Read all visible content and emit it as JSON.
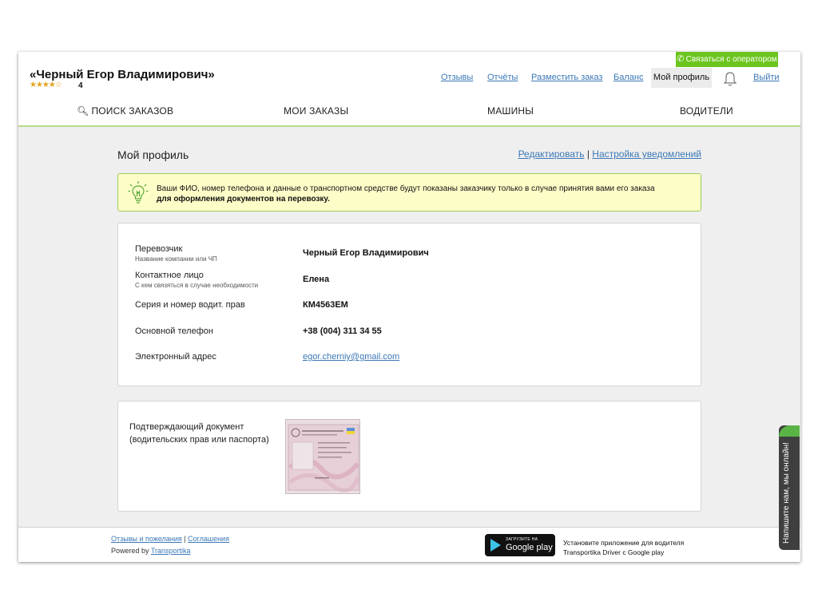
{
  "header": {
    "operator_button": "Связаться с оператором",
    "user_name": "«Черный Егор Владимирович»",
    "rating_stars": "★★★★☆",
    "rating_count": "4",
    "links": {
      "reviews": "Отзывы",
      "reports": "Отчёты",
      "place_order": "Разместить заказ",
      "balance": "Баланс",
      "my_profile": "Мой профиль",
      "logout": "Выйти"
    },
    "nav": {
      "search_orders": "ПОИСК ЗАКАЗОВ",
      "my_orders": "МОИ ЗАКАЗЫ",
      "vehicles": "МАШИНЫ",
      "drivers": "ВОДИТЕЛИ"
    }
  },
  "main": {
    "title": "Мой профиль",
    "edit_link": "Редактировать",
    "separator": "|",
    "notifications_link": "Настройка уведомлений",
    "notice_line1": "Ваши ФИО, номер телефона и данные о транспортном средстве будут показаны заказчику только в случае принятия вами его заказа",
    "notice_line2": "для оформления документов на перевозку.",
    "fields": [
      {
        "label": "Перевозчик",
        "sublabel": "Название компании или ЧП",
        "value": "Черный Егор Владимирович"
      },
      {
        "label": "Контактное лицо",
        "sublabel": "С кем связяться в случае необходимости",
        "value": "Елена"
      },
      {
        "label": "Серия и номер водит. прав",
        "sublabel": "",
        "value": "КМ4563ЕМ"
      },
      {
        "label": "Основной телефон",
        "sublabel": "",
        "value": "+38 (004) 311 34 55"
      },
      {
        "label": "Электронный адрес",
        "sublabel": "",
        "value": "egor.cherniy@gmail.com"
      }
    ],
    "document": {
      "label_line1": "Подтверждающий документ",
      "label_line2": "(водительских прав или паспорта)"
    }
  },
  "footer": {
    "feedback_link": "Отзывы и пожелания",
    "separator": "|",
    "agreements_link": "Соглашения",
    "powered_by": "Powered by",
    "powered_link": "Transportika",
    "gplay_small": "ЗАГРУЗИТЕ НА",
    "gplay_big": "Google play",
    "app_line1": "Установите приложение для водителя",
    "app_line2": "Transportika Driver с Google play"
  },
  "chat": {
    "text": "Напишите нам, мы онлайн!"
  },
  "colors": {
    "accent_green": "#6cc51e",
    "link_blue": "#3b78b6",
    "notice_bg": "#fdfdc8",
    "star": "#e3a21a"
  }
}
